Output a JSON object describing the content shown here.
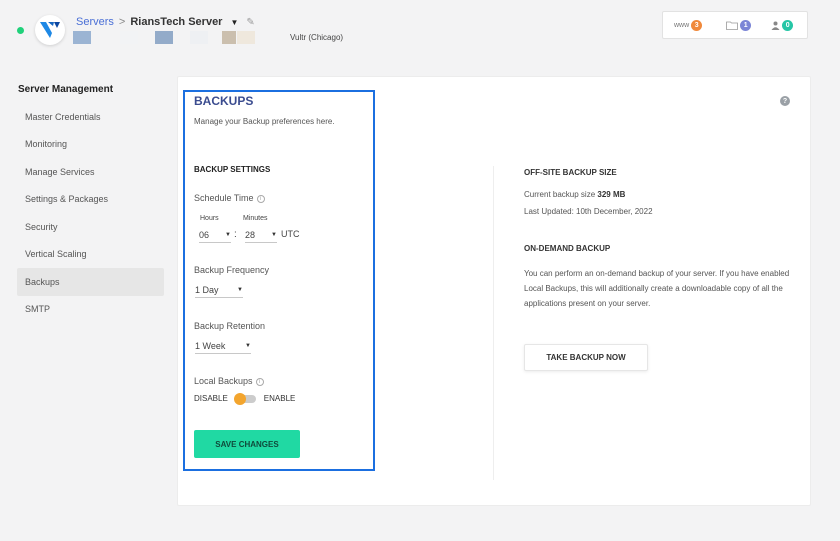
{
  "header": {
    "breadcrumb_root": "Servers",
    "breadcrumb_sep": ">",
    "server_name": "RiansTech Server",
    "vendor": "Vultr (Chicago)",
    "counters": [
      {
        "label": "www",
        "count": "3",
        "color": "#f0893b",
        "icon": "globe-text"
      },
      {
        "label": "",
        "count": "1",
        "color": "#7b85d6",
        "icon": "folder-icon"
      },
      {
        "label": "",
        "count": "0",
        "color": "#26c6a6",
        "icon": "users-icon"
      }
    ]
  },
  "sidebar": {
    "title": "Server Management",
    "items": [
      {
        "label": "Master Credentials",
        "active": false
      },
      {
        "label": "Monitoring",
        "active": false
      },
      {
        "label": "Manage Services",
        "active": false
      },
      {
        "label": "Settings & Packages",
        "active": false
      },
      {
        "label": "Security",
        "active": false
      },
      {
        "label": "Vertical Scaling",
        "active": false
      },
      {
        "label": "Backups",
        "active": true
      },
      {
        "label": "SMTP",
        "active": false
      }
    ]
  },
  "backups": {
    "title": "BACKUPS",
    "description": "Manage your Backup preferences here.",
    "settings_title": "BACKUP SETTINGS",
    "schedule_label": "Schedule Time",
    "hours_label": "Hours",
    "minutes_label": "Minutes",
    "hours_value": "06",
    "minutes_value": "28",
    "timezone": "UTC",
    "frequency_label": "Backup Frequency",
    "frequency_value": "1 Day",
    "retention_label": "Backup Retention",
    "retention_value": "1 Week",
    "local_label": "Local Backups",
    "disable_label": "DISABLE",
    "enable_label": "ENABLE",
    "save_label": "SAVE CHANGES"
  },
  "offsite": {
    "title": "OFF-SITE BACKUP SIZE",
    "size_prefix": "Current backup size",
    "size_value": "329 MB",
    "last_updated": "Last Updated: 10th December, 2022"
  },
  "ondemand": {
    "title": "ON-DEMAND BACKUP",
    "text": "You can perform an on-demand backup of your server. If you have enabled Local Backups, this will additionally create a downloadable copy of all the applications present on your server.",
    "button_label": "TAKE BACKUP NOW"
  },
  "colors": {
    "accent": "#20d9a3",
    "toggle_knob": "#f3a52e",
    "focus_outline": "#1b6fe0",
    "status_online": "#1fd17a"
  }
}
